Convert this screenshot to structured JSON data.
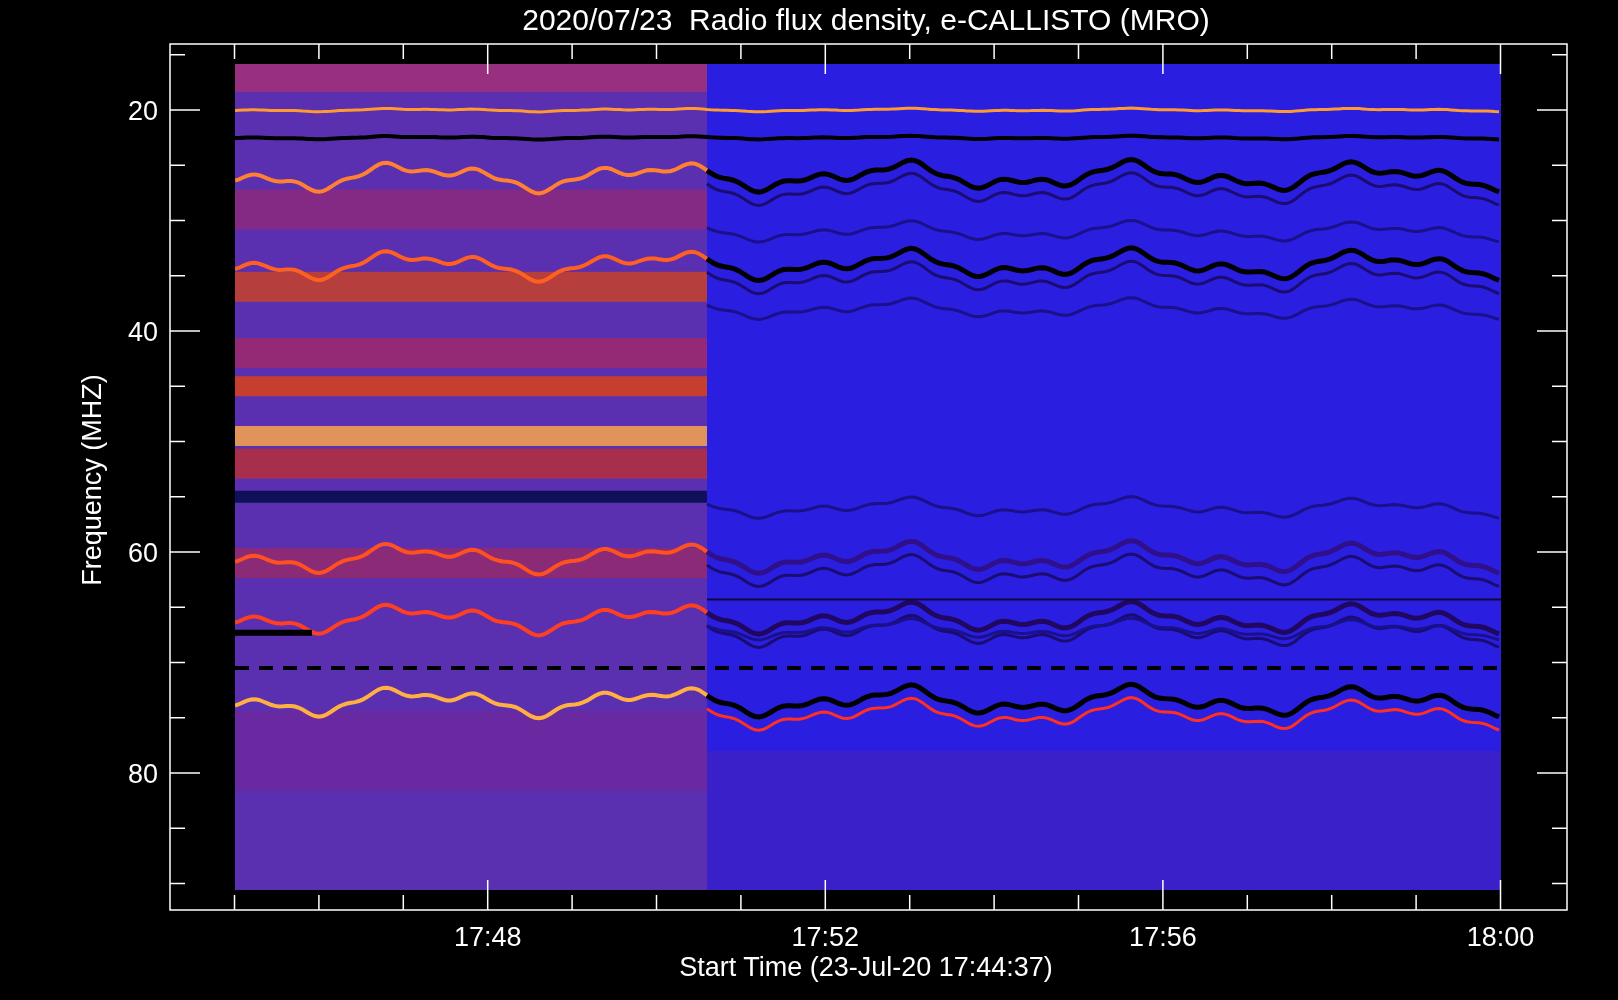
{
  "title": "2020/07/23  Radio flux density, e-CALLISTO (MRO)",
  "y_axis": {
    "label": "Frequency (MHZ)",
    "ticks": [
      "20",
      "40",
      "60",
      "80"
    ]
  },
  "x_axis": {
    "label": "Start Time (23-Jul-20 17:44:37)",
    "ticks": [
      "17:48",
      "17:52",
      "17:56",
      "18:00"
    ]
  }
}
